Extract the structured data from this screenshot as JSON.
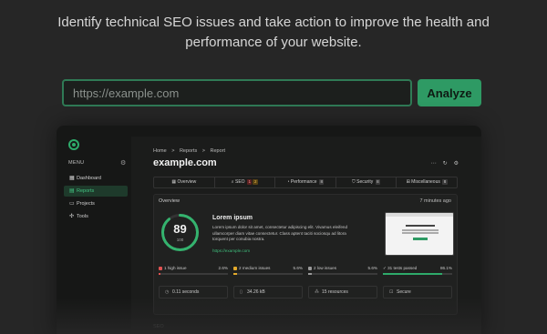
{
  "hero": {
    "line1": "Identify technical SEO issues and take action to improve the health and",
    "line2": "performance of your website."
  },
  "search": {
    "placeholder": "https://example.com",
    "button_label": "Analyze"
  },
  "colors": {
    "accent": "#2e9a64",
    "background": "#262626"
  },
  "app": {
    "sidebar": {
      "menu_label": "MENU",
      "items": [
        {
          "label": "Dashboard",
          "icon": "grid-icon"
        },
        {
          "label": "Reports",
          "icon": "chart-icon",
          "active": true
        },
        {
          "label": "Projects",
          "icon": "folder-icon"
        },
        {
          "label": "Tools",
          "icon": "wrench-icon"
        }
      ]
    },
    "breadcrumb": [
      "Home",
      ">",
      "Reports",
      ">",
      "Report"
    ],
    "domain": "example.com",
    "tabs": [
      {
        "label": "Overview"
      },
      {
        "label": "SEO",
        "badges": [
          "1",
          "2"
        ]
      },
      {
        "label": "Performance",
        "badges": [
          "8"
        ]
      },
      {
        "label": "Security",
        "badges": [
          "8"
        ]
      },
      {
        "label": "Miscellaneous",
        "badges": [
          "8"
        ]
      }
    ],
    "overview": {
      "title": "Overview",
      "time": "7 minutes ago",
      "score": 89,
      "score_max": "100",
      "lorem_title": "Lorem ipsum",
      "lorem_body": "Lorem ipsum dolor sit amet, consectetur adipiscing elit. Vivamus eleifend ullamcorper diam vitae consectetur. Class aptent taciti sociosqu ad litora torquent per conubia nostra.",
      "link": "https://example.com",
      "issues": [
        {
          "label": "1 high issue",
          "pct": "2.6%",
          "fraction": 0.026,
          "color": "#e05252"
        },
        {
          "label": "2 medium issues",
          "pct": "5.6%",
          "fraction": 0.056,
          "color": "#e3aa2b"
        },
        {
          "label": "2 low issues",
          "pct": "5.6%",
          "fraction": 0.056,
          "color": "#9a9a9a"
        },
        {
          "label": "✓ 31 tests passed",
          "pct": "86.1%",
          "fraction": 0.861,
          "color": "#2eaa6a"
        }
      ],
      "stats": [
        {
          "icon": "clock-icon",
          "value": "0.11 seconds"
        },
        {
          "icon": "file-icon",
          "value": "34.26 kB"
        },
        {
          "icon": "resources-icon",
          "value": "15 resources"
        },
        {
          "icon": "lock-icon",
          "value": "Secure"
        }
      ]
    },
    "footer_label": "SEO"
  }
}
